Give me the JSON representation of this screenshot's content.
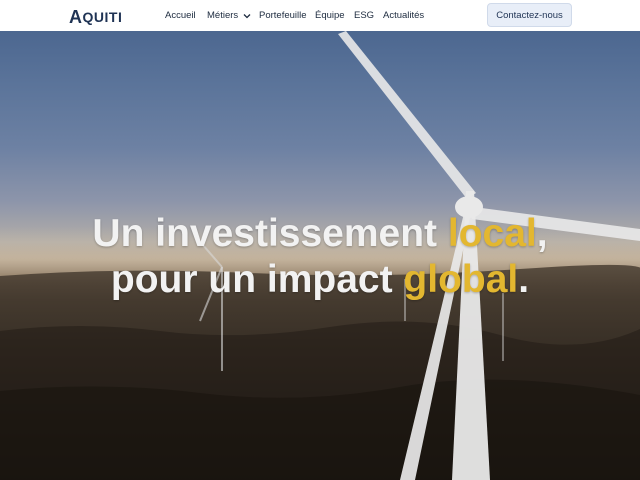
{
  "header": {
    "logo": {
      "first": "A",
      "rest": "QUITI"
    },
    "nav": [
      {
        "label": "Accueil"
      },
      {
        "label": "Métiers",
        "dropdown": true
      },
      {
        "label": "Portefeuille"
      },
      {
        "label": "Équipe"
      },
      {
        "label": "ESG"
      },
      {
        "label": "Actualités"
      }
    ],
    "cta_label": "Contactez-nous"
  },
  "hero": {
    "line1_a": "Un investissement ",
    "line1_hl": "local",
    "line1_b": ",",
    "line2_a": "pour un impact ",
    "line2_hl": "global",
    "line2_b": "."
  },
  "colors": {
    "brand_navy": "#1f3354",
    "highlight_yellow": "#e3b730",
    "cta_bg": "#e8eef8"
  },
  "icons": {
    "dropdown": "chevron-down-icon"
  }
}
